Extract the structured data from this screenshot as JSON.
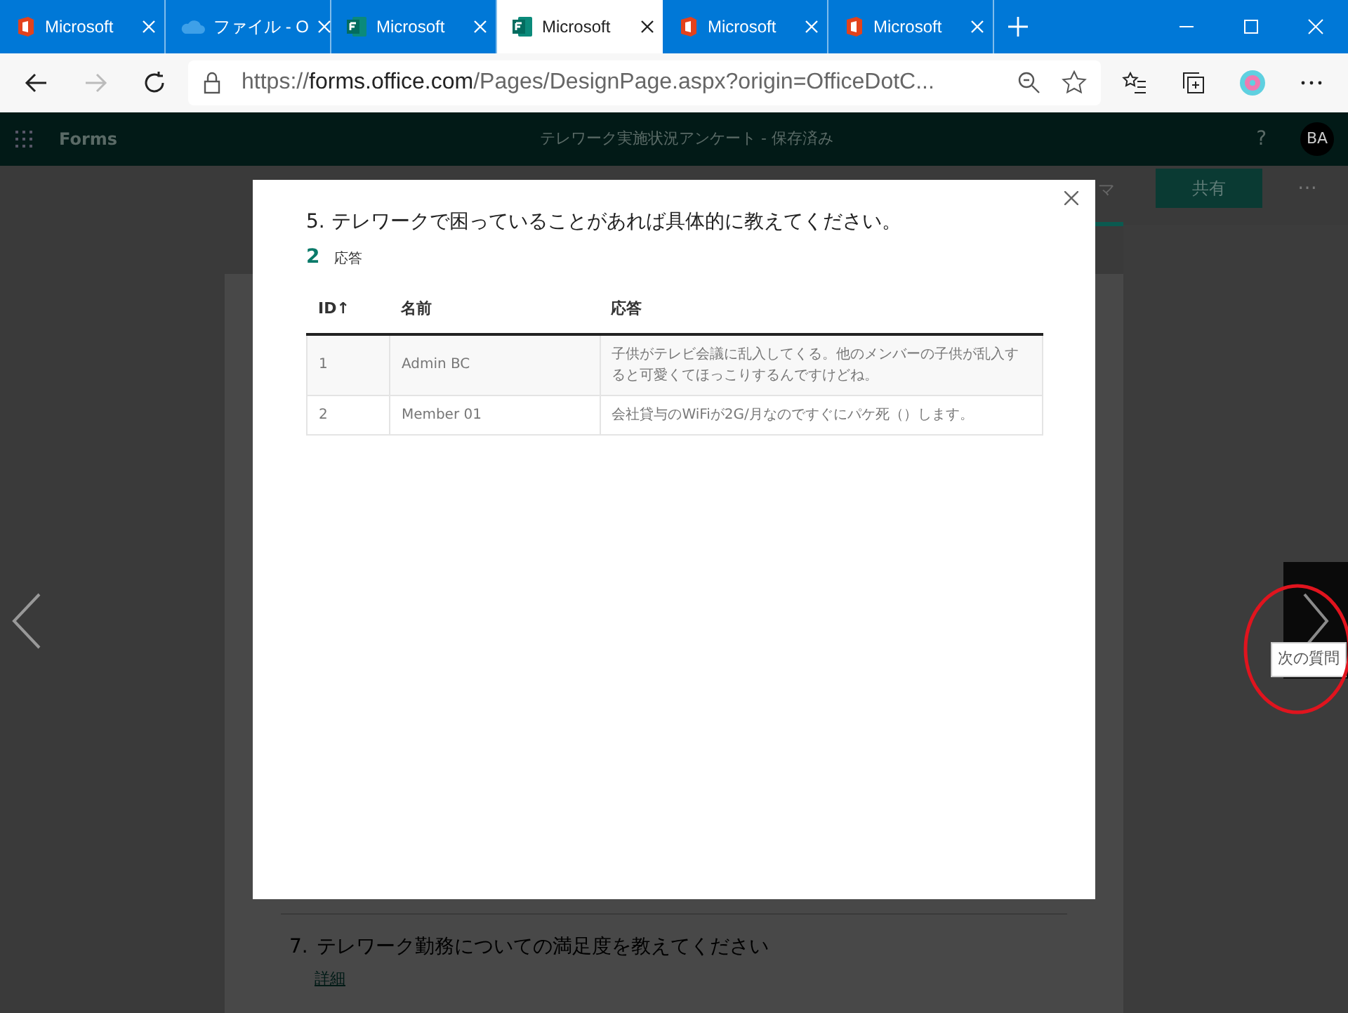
{
  "browser": {
    "tabs": [
      {
        "label": "Microsoft",
        "kind": "office",
        "selected": false
      },
      {
        "label": "ファイル - O",
        "kind": "cloud",
        "selected": false
      },
      {
        "label": "Microsoft",
        "kind": "forms",
        "selected": false
      },
      {
        "label": "Microsoft",
        "kind": "forms",
        "selected": true
      },
      {
        "label": "Microsoft",
        "kind": "office",
        "selected": false
      },
      {
        "label": "Microsoft",
        "kind": "office",
        "selected": false
      }
    ],
    "address": {
      "scheme": "https://",
      "host": "forms.office.com",
      "path": "/Pages/DesignPage.aspx?origin=OfficeDotC..."
    }
  },
  "app_header": {
    "app_name": "Forms",
    "title": "テレワーク実施状況アンケート - 保存済み",
    "help": "?",
    "avatar": "BA"
  },
  "page_toolbar": {
    "partial_tab": "マ",
    "share_button": "共有",
    "more": "⋯"
  },
  "modal": {
    "question": "5. テレワークで困っていることがあれば具体的に教えてください。",
    "count": "2",
    "count_label": "応答",
    "table": {
      "columns": [
        "ID↑",
        "名前",
        "応答"
      ],
      "rows": [
        [
          "1",
          "Admin BC",
          "子供がテレビ会議に乱入してくる。他のメンバーの子供が乱入すると可愛くてほっこりするんですけどね。"
        ],
        [
          "2",
          "Member 01",
          "会社貸与のWiFiが2G/月なのですぐにパケ死（）します。"
        ]
      ]
    }
  },
  "next_tooltip": "次の質問",
  "behind": {
    "number": "7.",
    "question": "テレワーク勤務についての満足度を教えてください",
    "link": "詳細"
  }
}
